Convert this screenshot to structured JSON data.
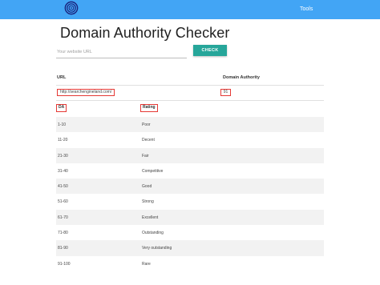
{
  "header": {
    "tools_label": "Tools",
    "logo_icon": "swirl-logo-icon",
    "bar_color": "#42a5f5"
  },
  "page_title": "Domain Authority Checker",
  "search": {
    "placeholder": "Your website URL",
    "value": "",
    "button_label": "CHECK",
    "button_color": "#26a69a"
  },
  "results": {
    "columns": [
      "URL",
      "Domain Authority"
    ],
    "url": "http://searchengineland.com/",
    "domain_authority": "91",
    "highlight_color": "#e53935"
  },
  "legend": {
    "columns": [
      "DA",
      "Rating"
    ],
    "rows": [
      [
        "1-10",
        "Poor"
      ],
      [
        "11-20",
        "Decent"
      ],
      [
        "21-30",
        "Fair"
      ],
      [
        "31-40",
        "Competitive"
      ],
      [
        "41-50",
        "Good"
      ],
      [
        "51-60",
        "Strong"
      ],
      [
        "61-70",
        "Excellent"
      ],
      [
        "71-80",
        "Outstanding"
      ],
      [
        "81-90",
        "Very outstanding"
      ],
      [
        "91-100",
        "Rare"
      ]
    ]
  }
}
